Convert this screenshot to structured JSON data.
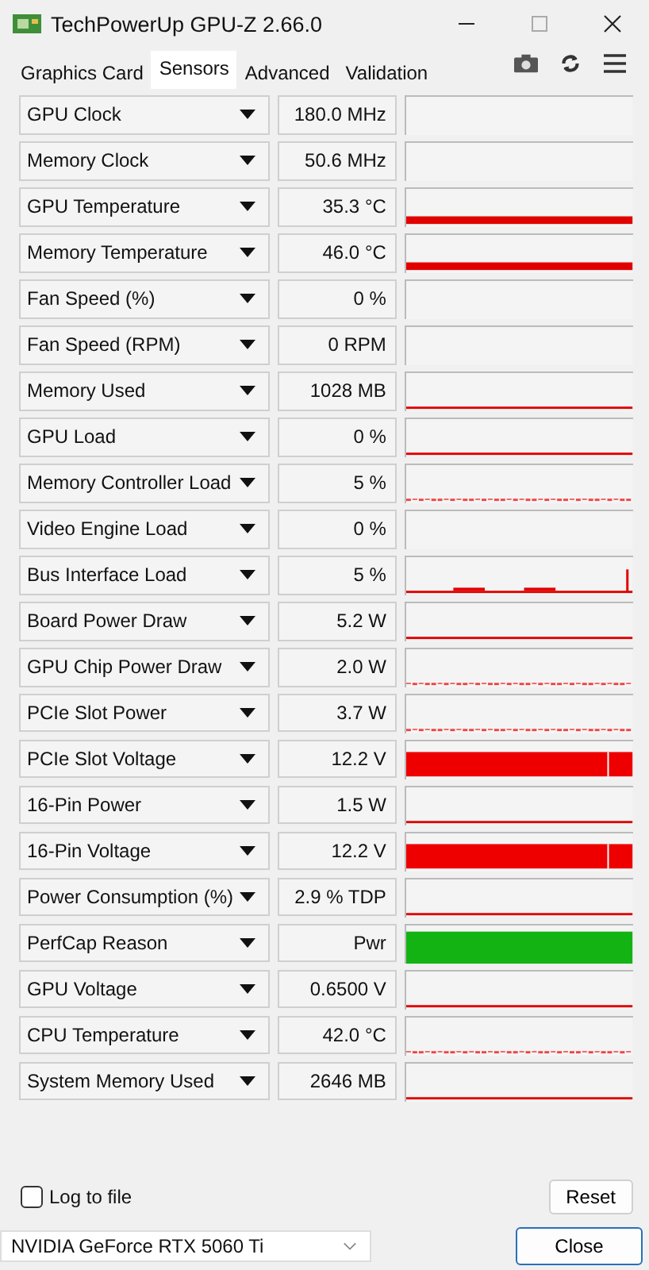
{
  "window": {
    "title": "TechPowerUp GPU-Z 2.66.0"
  },
  "tabs": [
    {
      "label": "Graphics Card",
      "selected": false
    },
    {
      "label": "Sensors",
      "selected": true
    },
    {
      "label": "Advanced",
      "selected": false
    },
    {
      "label": "Validation",
      "selected": false
    }
  ],
  "sensors": [
    {
      "name": "GPU Clock",
      "value": "180.0 MHz",
      "kind": "none"
    },
    {
      "name": "Memory Clock",
      "value": "50.6 MHz",
      "kind": "none"
    },
    {
      "name": "GPU Temperature",
      "value": "35.3 °C",
      "kind": "band"
    },
    {
      "name": "Memory Temperature",
      "value": "46.0 °C",
      "kind": "band"
    },
    {
      "name": "Fan Speed (%)",
      "value": "0 %",
      "kind": "none"
    },
    {
      "name": "Fan Speed (RPM)",
      "value": "0 RPM",
      "kind": "none"
    },
    {
      "name": "Memory Used",
      "value": "1028 MB",
      "kind": "line"
    },
    {
      "name": "GPU Load",
      "value": "0 %",
      "kind": "line"
    },
    {
      "name": "Memory Controller Load",
      "value": "5 %",
      "kind": "noise"
    },
    {
      "name": "Video Engine Load",
      "value": "0 %",
      "kind": "none"
    },
    {
      "name": "Bus Interface Load",
      "value": "5 %",
      "kind": "spikes"
    },
    {
      "name": "Board Power Draw",
      "value": "5.2 W",
      "kind": "line"
    },
    {
      "name": "GPU Chip Power Draw",
      "value": "2.0 W",
      "kind": "noise"
    },
    {
      "name": "PCIe Slot Power",
      "value": "3.7 W",
      "kind": "noise"
    },
    {
      "name": "PCIe Slot Voltage",
      "value": "12.2 V",
      "kind": "fill"
    },
    {
      "name": "16-Pin Power",
      "value": "1.5 W",
      "kind": "line"
    },
    {
      "name": "16-Pin Voltage",
      "value": "12.2 V",
      "kind": "fill"
    },
    {
      "name": "Power Consumption (%)",
      "value": "2.9 % TDP",
      "kind": "line"
    },
    {
      "name": "PerfCap Reason",
      "value": "Pwr",
      "kind": "perfcap"
    },
    {
      "name": "GPU Voltage",
      "value": "0.6500 V",
      "kind": "line"
    },
    {
      "name": "CPU Temperature",
      "value": "42.0 °C",
      "kind": "noise"
    },
    {
      "name": "System Memory Used",
      "value": "2646 MB",
      "kind": "line"
    }
  ],
  "log_to_file": {
    "label": "Log to file",
    "checked": false
  },
  "reset_button": "Reset",
  "gpu_select": "NVIDIA GeForce RTX 5060 Ti",
  "close_button": "Close"
}
